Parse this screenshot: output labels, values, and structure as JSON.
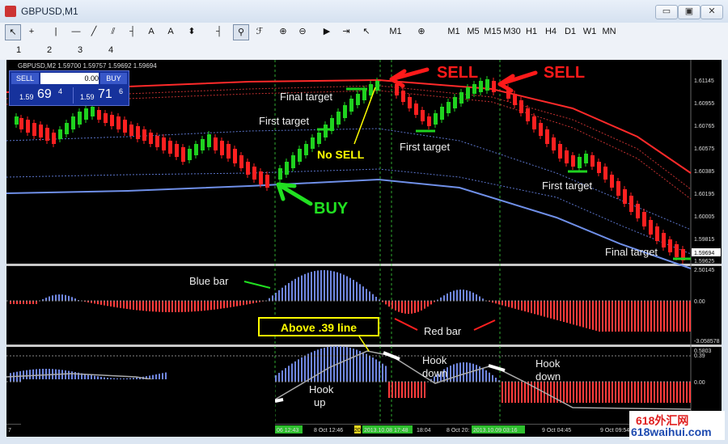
{
  "window": {
    "title": "GBPUSD,M1",
    "minimize": "▭",
    "restore": "▣",
    "close": "✕"
  },
  "toolbar": {
    "timeframes": [
      "M1",
      "M5",
      "M15",
      "M30",
      "H1",
      "H4",
      "D1",
      "W1",
      "MN"
    ],
    "period_button": "M1",
    "line_numbers": [
      "1",
      "2",
      "3",
      "4"
    ],
    "tools": {
      "cursor": "↖",
      "crosshair": "+",
      "vline": "|",
      "hline": "—",
      "trend": "╱",
      "channel": "⫽",
      "text": "A",
      "label": "A",
      "arrows": "⬍",
      "fib": "┤",
      "anchor": "⚲",
      "fn": "ℱ",
      "zoom_in": "⊕",
      "zoom_out": "⊖",
      "scroll": "▶",
      "autoscroll": "⇥"
    }
  },
  "trade_panel": {
    "symbol_header": "GBPUSD,M2  1.59700 1.59757 1.59692 1.59694",
    "sell": "SELL",
    "buy": "BUY",
    "lot": "0.00",
    "sell_big": "69",
    "sell_small": "1.59",
    "sell_sup": "4",
    "buy_big": "71",
    "buy_small": "1.59",
    "buy_sup": "6"
  },
  "annotations": {
    "sell1": "SELL",
    "sell2": "SELL",
    "buy": "BUY",
    "no_sell": "No SELL",
    "final_target1": "Final target",
    "first_target1": "First target",
    "first_target2": "First target",
    "first_target3": "First target",
    "final_target2": "Final target",
    "blue_bar": "Blue bar",
    "red_bar": "Red bar",
    "above_line": "Above .39 line",
    "hook_up": "Hook up",
    "hook_down1": "Hook down",
    "hook_down2": "Hook down"
  },
  "price_axis": [
    "1.61145",
    "1.60955",
    "1.60765",
    "1.60575",
    "1.60385",
    "1.60195",
    "1.60005",
    "1.59815",
    "1.59694",
    "1.59625"
  ],
  "osc1_axis": [
    "2.50145",
    "0.00",
    "-3.058578"
  ],
  "osc2_axis": [
    "0.5803",
    "0.39",
    "0.00"
  ],
  "time_axis": [
    "7",
    "8 Oct 12:46",
    "2013.10.08 17:48",
    "18:04",
    "8 Oct 20:",
    "2013.10.09 03:16",
    "9 Oct 04:45",
    "9 Oct 09:54",
    "9"
  ],
  "time_axis_highlight": [
    "06 12:43",
    "20"
  ],
  "watermark": {
    "line1": "618外汇网",
    "line2": "618waihui.com"
  },
  "colors": {
    "bull": "#1fd21f",
    "bear": "#ff2020",
    "band_red": "#ff2a2a",
    "band_blue": "#6f8fe8",
    "osc_blue": "#6f86e0",
    "osc_red": "#ff3b3b",
    "text_green": "#21e021",
    "text_yellow": "#ffff00"
  }
}
